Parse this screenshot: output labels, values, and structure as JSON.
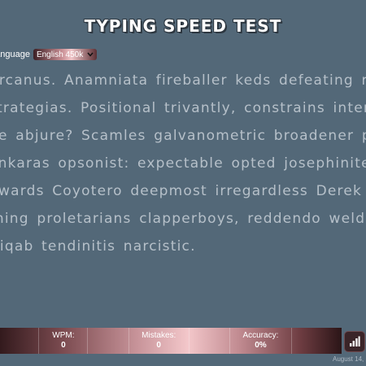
{
  "header": {
    "title": "TYPING SPEED TEST"
  },
  "language": {
    "label": "Language",
    "selected": "English 450k"
  },
  "text_lines": [
    "Arcanus. Anamniata fireballer keds defeating recoiled",
    "strategias. Positional trivantly, constrains intertear hep",
    "ge abjure? Scamles galvanometric broadener passer",
    "onkaras opsonist: expectable opted josephinite overb",
    "nwards Coyotero deepmost irregardless Derek tits pa",
    "rning proletarians clapperboys, reddendo welded ten",
    "Niqab tendinitis narcistic."
  ],
  "stats": {
    "wpm_label": "WPM:",
    "wpm_value": "0",
    "mistakes_label": "Mistakes:",
    "mistakes_value": "0",
    "accuracy_label": "Accuracy:",
    "accuracy_value": "0%"
  },
  "footer": {
    "date": "August 14, 2"
  },
  "icons": {
    "stats_button": "bar-chart-icon",
    "dropdown": "chevron-down-icon"
  },
  "colors": {
    "background": "#536878",
    "text": "#b6c0c9",
    "title": "#ffffff"
  }
}
